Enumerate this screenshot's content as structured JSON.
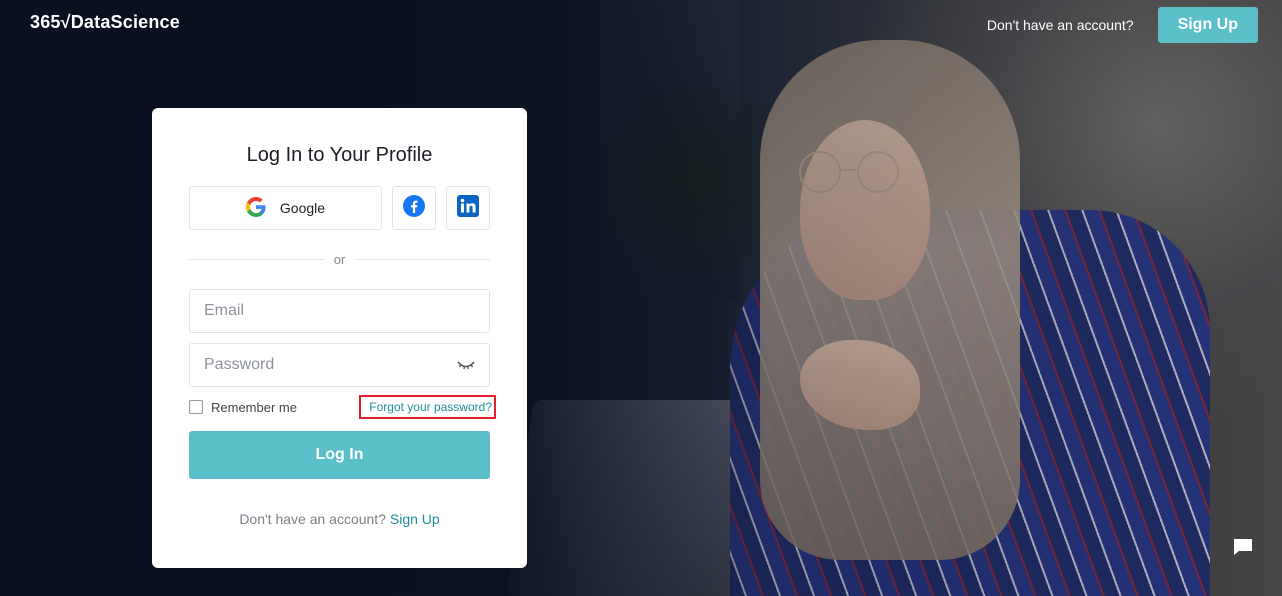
{
  "header": {
    "logo_text": "365√DataScience",
    "account_question": "Don't have an account?",
    "signup_label": "Sign Up"
  },
  "card": {
    "title": "Log In to Your Profile",
    "google_label": "Google",
    "or_label": "or",
    "email_placeholder": "Email",
    "password_placeholder": "Password",
    "remember_label": "Remember me",
    "forgot_label": "Forgot your password?",
    "login_label": "Log In",
    "bottom_question": "Don't have an account?",
    "bottom_signup": "Sign Up"
  },
  "icons": [
    "google-icon",
    "facebook-icon",
    "linkedin-icon",
    "eye-closed-icon",
    "chat-icon"
  ],
  "colors": {
    "accent": "#5bbfc9",
    "link": "#1f8f9a",
    "highlight": "#e0202a",
    "facebook": "#1877f2",
    "linkedin": "#0a66c2"
  }
}
